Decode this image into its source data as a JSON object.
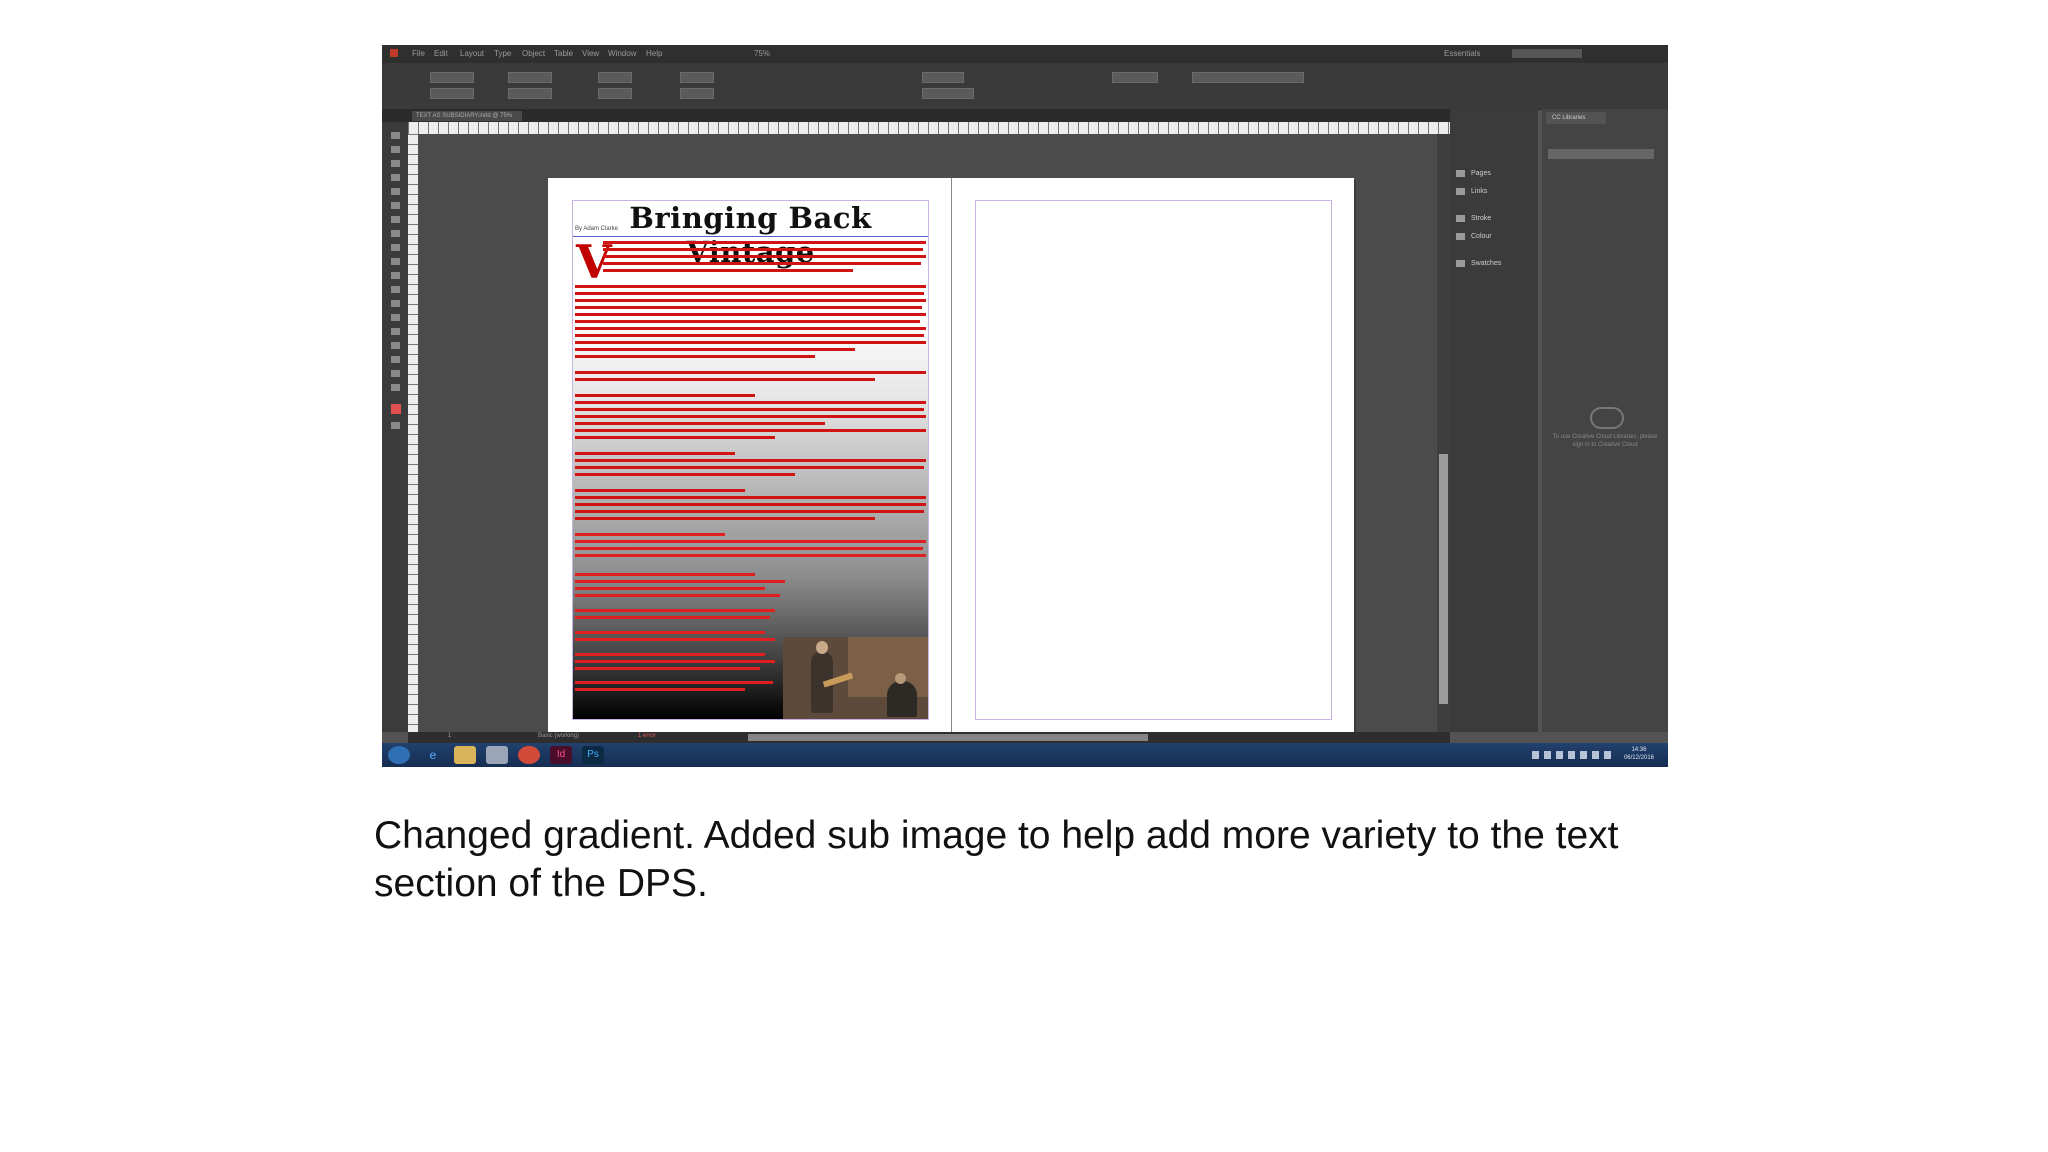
{
  "app": {
    "menu": [
      "File",
      "Edit",
      "Layout",
      "Type",
      "Object",
      "Table",
      "View",
      "Window",
      "Help"
    ],
    "zoom": "75%",
    "workspace_label": "Essentials",
    "search_placeholder": "",
    "document_tab": "TEXT AS SUBSIDIARY.indd @ 75%"
  },
  "document": {
    "headline": "Bringing Back Vintage",
    "byline": "By Adam Clarke",
    "drop_cap": "V"
  },
  "dock": {
    "items": [
      "Pages",
      "Links",
      "Stroke",
      "Colour",
      "Swatches"
    ]
  },
  "panel": {
    "tab": "CC Libraries",
    "message": "To use Creative Cloud Libraries, please sign in to Creative Cloud"
  },
  "statusbar": {
    "page": "1",
    "preflight": "Basic (working)",
    "errors": "1 error"
  },
  "taskbar": {
    "time": "14:36",
    "date": "06/12/2016"
  },
  "caption": "Changed gradient. Added sub image to help add more variety to the text section of the DPS."
}
